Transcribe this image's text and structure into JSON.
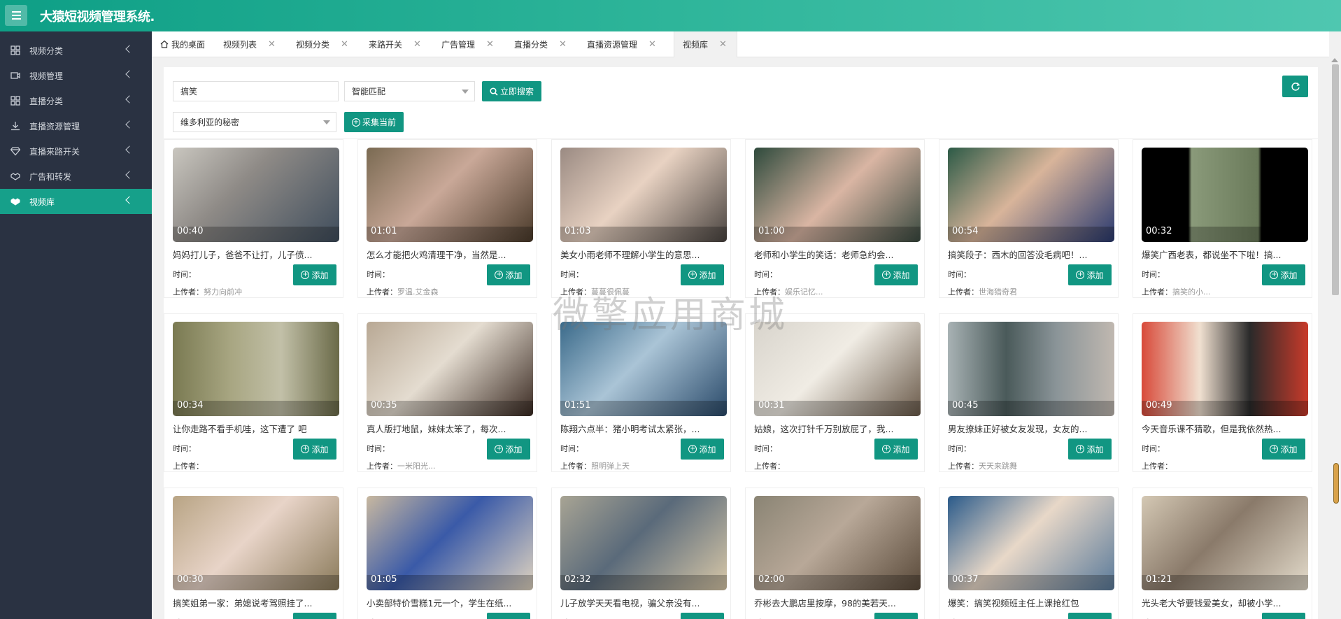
{
  "app": {
    "title": "大猿短视频管理系统."
  },
  "sidebar": {
    "items": [
      {
        "label": "视频分类",
        "icon": "grid-icon"
      },
      {
        "label": "视频管理",
        "icon": "video-icon"
      },
      {
        "label": "直播分类",
        "icon": "grid-icon"
      },
      {
        "label": "直播资源管理",
        "icon": "download-icon"
      },
      {
        "label": "直播来路开关",
        "icon": "diamond-icon"
      },
      {
        "label": "广告和转发",
        "icon": "handshake-icon"
      },
      {
        "label": "视频库",
        "icon": "handshake-icon",
        "active": true
      }
    ]
  },
  "tabs": [
    {
      "label": "我的桌面",
      "home": true
    },
    {
      "label": "视频列表"
    },
    {
      "label": "视频分类"
    },
    {
      "label": "来路开关"
    },
    {
      "label": "广告管理"
    },
    {
      "label": "直播分类"
    },
    {
      "label": "直播资源管理"
    },
    {
      "label": "视频库",
      "active": true
    }
  ],
  "filters": {
    "keyword": "搞笑",
    "match_mode": "智能匹配",
    "search_button": "立即搜索",
    "source": "维多利亚的秘密",
    "collect_button": "采集当前"
  },
  "labels": {
    "time": "时间：",
    "uploader": "上传者：",
    "add": "添加"
  },
  "watermark": "微擎应用商城",
  "videos": [
    {
      "duration": "00:40",
      "title": "妈妈打儿子，爸爸不让打，儿子偾...",
      "uploader": "努力向前冲"
    },
    {
      "duration": "01:01",
      "title": "怎么才能把火鸡清理干净，当然是...",
      "uploader": "罗温.艾金森"
    },
    {
      "duration": "01:03",
      "title": "美女小雨老师不理解小学生的意思...",
      "uploader": "蔓蔓很佩蔓"
    },
    {
      "duration": "01:00",
      "title": "老师和小学生的笑话：老师急约会...",
      "uploader": "娱乐记忆..."
    },
    {
      "duration": "00:54",
      "title": "搞笑段子：西木的回答没毛病吧！...",
      "uploader": "世海猎奇君"
    },
    {
      "duration": "00:32",
      "title": "爆笑广西老表，都说坐不下啦！搞...",
      "uploader": "搞笑的小..."
    },
    {
      "duration": "00:34",
      "title": "让你走路不看手机哇，这下遭了 吧",
      "uploader": ""
    },
    {
      "duration": "00:35",
      "title": "真人版打地鼠，妹妹太笨了，每次...",
      "uploader": "一米阳光..."
    },
    {
      "duration": "01:51",
      "title": "陈翔六点半：猪小明考试太紧张，...",
      "uploader": "照明弹上天"
    },
    {
      "duration": "00:31",
      "title": "姑娘，这次打针千万别放屁了，我...",
      "uploader": ""
    },
    {
      "duration": "00:45",
      "title": "男友撩妹正好被女友发现，女友的...",
      "uploader": "天天来跳舞"
    },
    {
      "duration": "00:49",
      "title": "今天音乐课不猜歌，但是我依然热...",
      "uploader": ""
    },
    {
      "duration": "00:30",
      "title": "搞笑姐弟一家：弟媳说考驾照挂了...",
      "uploader": ""
    },
    {
      "duration": "01:05",
      "title": "小卖部特价雪糕1元一个，学生在纸...",
      "uploader": ""
    },
    {
      "duration": "02:32",
      "title": "儿子放学天天看电视，骗父亲没有...",
      "uploader": ""
    },
    {
      "duration": "02:00",
      "title": "乔彬去大鹏店里按摩，98的美若天...",
      "uploader": ""
    },
    {
      "duration": "00:37",
      "title": "爆笑：搞笑视频班主任上课抢红包",
      "uploader": ""
    },
    {
      "duration": "01:21",
      "title": "光头老大爷要钱爱美女，却被小学...",
      "uploader": ""
    }
  ]
}
